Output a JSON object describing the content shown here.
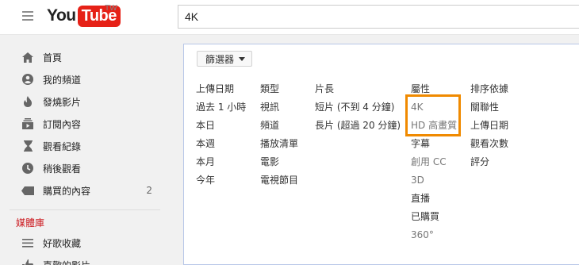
{
  "header": {
    "logo_you": "You",
    "logo_tube": "Tube",
    "logo_region": "TW",
    "search_value": "4K"
  },
  "sidebar": {
    "items": [
      {
        "label": "首頁",
        "icon": "home-icon"
      },
      {
        "label": "我的頻道",
        "icon": "account-icon"
      },
      {
        "label": "發燒影片",
        "icon": "flame-icon"
      },
      {
        "label": "訂閱內容",
        "icon": "subscriptions-icon"
      },
      {
        "label": "觀看紀錄",
        "icon": "hourglass-icon"
      },
      {
        "label": "稍後觀看",
        "icon": "clock-icon"
      },
      {
        "label": "購買的內容",
        "icon": "tag-icon",
        "count": "2"
      }
    ],
    "section_title": "媒體庫",
    "library": [
      {
        "label": "好歌收藏",
        "icon": "playlist-icon"
      },
      {
        "label": "喜歡的影片",
        "icon": "thumb-up-icon"
      }
    ]
  },
  "filter": {
    "button_label": "篩選器",
    "columns": [
      {
        "heading": "上傳日期",
        "items": [
          "過去 1 小時",
          "本日",
          "本週",
          "本月",
          "今年"
        ]
      },
      {
        "heading": "類型",
        "items": [
          "視訊",
          "頻道",
          "播放清單",
          "電影",
          "電視節目"
        ]
      },
      {
        "heading": "片長",
        "items": [
          "短片 (不到 4 分鐘)",
          "長片 (超過 20 分鐘)"
        ]
      },
      {
        "heading": "屬性",
        "items": [
          "4K",
          "HD 高畫質",
          "字幕",
          "創用 CC",
          "3D",
          "直播",
          "已購買",
          "360°"
        ]
      },
      {
        "heading": "排序依據",
        "items": [
          "關聯性",
          "上傳日期",
          "觀看次數",
          "評分"
        ]
      }
    ]
  },
  "colors": {
    "brand_red": "#e62117",
    "highlight_orange": "#f08a00",
    "section_red": "#cc181e"
  }
}
